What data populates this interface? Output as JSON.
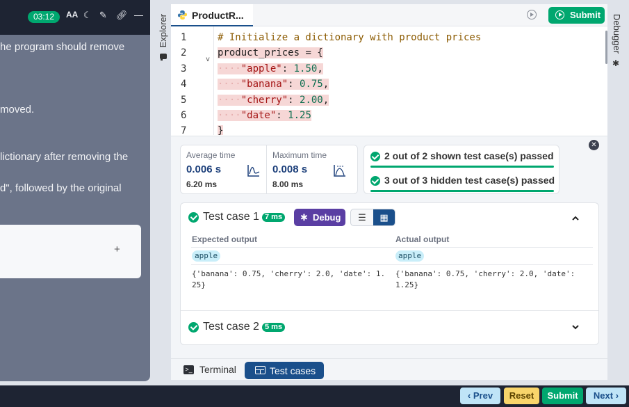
{
  "header": {
    "timer": "03:12"
  },
  "problem": {
    "lines": [
      "he program should remove",
      "moved.",
      "lictionary after removing the",
      "d\", followed by the original"
    ],
    "add_label": "+"
  },
  "rails": {
    "left_label": "Explorer",
    "right_label": "Debugger"
  },
  "editor": {
    "file_name": "ProductR...",
    "submit_label": "Submit",
    "line_numbers": [
      "1",
      "2",
      "3",
      "4",
      "5",
      "6",
      "7"
    ],
    "code": {
      "l1": "# Initialize a dictionary with product prices",
      "l2_name": "product_prices",
      "l2_rest": " = {",
      "l3_key": "\"apple\"",
      "l3_val": "1.50",
      "l4_key": "\"banana\"",
      "l4_val": "0.75",
      "l5_key": "\"cherry\"",
      "l5_val": "2.00",
      "l6_key": "\"date\"",
      "l6_val": "1.25",
      "l7": "}"
    }
  },
  "results": {
    "avg_label": "Average time",
    "avg_value": "0.006 s",
    "avg_sub": "6.20 ms",
    "max_label": "Maximum time",
    "max_value": "0.008 s",
    "max_sub": "8.00 ms",
    "shown_passed": "2 out of 2 shown test case(s) passed",
    "hidden_passed": "3 out of 3 hidden test case(s) passed",
    "case1": {
      "title": "Test case 1",
      "time": "7 ms",
      "debug_label": "Debug",
      "expected_label": "Expected output",
      "actual_label": "Actual output",
      "expected_line1": "apple",
      "actual_line1": "apple",
      "expected_line2": "{'banana': 0.75, 'cherry': 2.0, 'date': 1.\n25}",
      "actual_line2": "{'banana': 0.75, 'cherry': 2.0, 'date': \n1.25}"
    },
    "case2": {
      "title": "Test case 2",
      "time": "5 ms"
    }
  },
  "bottom_tabs": {
    "terminal": "Terminal",
    "test_cases": "Test cases"
  },
  "footer": {
    "prev": "Prev",
    "reset": "Reset",
    "submit": "Submit",
    "next": "Next"
  },
  "colors": {
    "accent_green": "#00a76f",
    "primary_blue": "#1a4f8b",
    "debug_purple": "#5a3ea3",
    "code_highlight": "#f6d7d6"
  }
}
